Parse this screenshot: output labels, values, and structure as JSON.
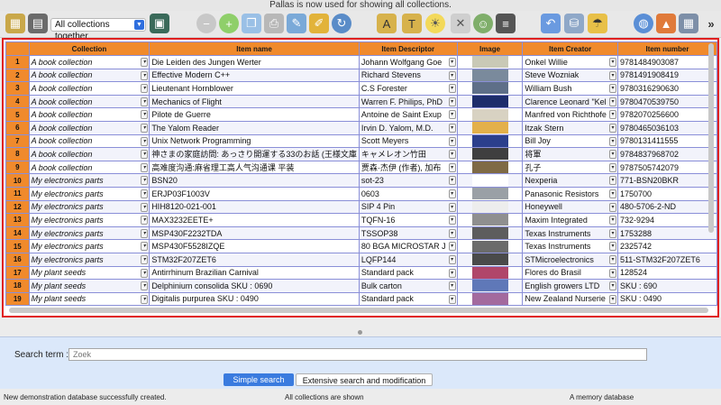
{
  "window": {
    "title": "Pallas is now used for showing all collections."
  },
  "toolbar": {
    "collection_select": "All collections together",
    "icons": [
      "app-icon",
      "barcode-scanner-icon",
      "collection-icon",
      "remove-icon",
      "add-icon",
      "clone-icon",
      "print-icon",
      "edit-icon",
      "edit-item-icon",
      "refresh-icon",
      "text-grow-icon",
      "text-style-icon",
      "lightbulb-icon",
      "tools-icon",
      "user-icon",
      "barcode-icon",
      "undo-icon",
      "database-icon",
      "umbrella-icon",
      "web-icon",
      "image-icon",
      "grid-icon",
      "more-icon"
    ],
    "more_label": "»"
  },
  "table": {
    "columns": [
      "",
      "Collection",
      "Item name",
      "Item Descriptor",
      "Image",
      "Item Creator",
      "Item number"
    ],
    "rows": [
      {
        "n": "1",
        "collection": "A book collection",
        "name": "Die Leiden des Jungen Werter",
        "descriptor": "Johann Wolfgang Goe",
        "creator": "Onkel Willie",
        "number": "9781484903087",
        "thumb": "#c9c9b6"
      },
      {
        "n": "2",
        "collection": "A book collection",
        "name": "Effective Modern C++",
        "descriptor": "Richard Stevens",
        "creator": "Steve Wozniak",
        "number": "9781491908419",
        "thumb": "#7a8a9c"
      },
      {
        "n": "3",
        "collection": "A book collection",
        "name": "Lieutenant Hornblower",
        "descriptor": "C.S Forester",
        "creator": "William Bush",
        "number": "9780316290630",
        "thumb": "#5e6f88"
      },
      {
        "n": "4",
        "collection": "A book collection",
        "name": "Mechanics of Flight",
        "descriptor": "Warren F. Philips, PhD",
        "creator": "Clarence Leonard \"Kel",
        "number": "9780470539750",
        "thumb": "#1d2d6b"
      },
      {
        "n": "5",
        "collection": "A book collection",
        "name": "Pilote de Guerre",
        "descriptor": "Antoine de Saint Exup",
        "creator": "Manfred von Richthofe",
        "number": "9782070256600",
        "thumb": "#d8d2c2"
      },
      {
        "n": "6",
        "collection": "A book collection",
        "name": "The Yalom Reader",
        "descriptor": "Irvin D. Yalom, M.D.",
        "creator": "Itzak Stern",
        "number": "9780465036103",
        "thumb": "#e3b04a"
      },
      {
        "n": "7",
        "collection": "A book collection",
        "name": "Unix Network Programming",
        "descriptor": "Scott Meyers",
        "creator": "Bill Joy",
        "number": "9780131411555",
        "thumb": "#2b3f8c"
      },
      {
        "n": "8",
        "collection": "A book collection",
        "name": "神さまの家庭訪問: あっさり開運する33のお話 (王様文庫",
        "descriptor": "キャメレオン竹田",
        "creator": "将軍",
        "number": "9784837968702",
        "thumb": "#3f3f3f"
      },
      {
        "n": "9",
        "collection": "A book collection",
        "name": "高难度沟通:麻省理工高人气沟通课 平装",
        "descriptor": "贾森·杰伊 (作者), 加布",
        "creator": "孔子",
        "number": "9787505742079",
        "thumb": "#7f6a45"
      },
      {
        "n": "10",
        "collection": "My electronics parts",
        "name": "BSN20",
        "descriptor": "sot-23",
        "creator": "Nexperia",
        "number": "771-BSN20BKR",
        "thumb": "#ffffff"
      },
      {
        "n": "11",
        "collection": "My electronics parts",
        "name": "ERJP03F1003V",
        "descriptor": "0603",
        "creator": "Panasonic Resistors",
        "number": "1750700",
        "thumb": "#9aa0a6"
      },
      {
        "n": "12",
        "collection": "My electronics parts",
        "name": "HIH8120-021-001",
        "descriptor": "SIP 4 Pin",
        "creator": "Honeywell",
        "number": "480-5706-2-ND",
        "thumb": "#ededed"
      },
      {
        "n": "13",
        "collection": "My electronics parts",
        "name": "MAX3232EETE+",
        "descriptor": "TQFN-16",
        "creator": "Maxim Integrated",
        "number": "732-9294",
        "thumb": "#8f8f8f"
      },
      {
        "n": "14",
        "collection": "My electronics parts",
        "name": "MSP430F2232TDA",
        "descriptor": "TSSOP38",
        "creator": "Texas Instruments",
        "number": "1753288",
        "thumb": "#5d5d5d"
      },
      {
        "n": "15",
        "collection": "My electronics parts",
        "name": "MSP430F5528IZQE",
        "descriptor": "80 BGA MICROSTAR J",
        "creator": "Texas Instruments",
        "number": "2325742",
        "thumb": "#6b6b6b"
      },
      {
        "n": "16",
        "collection": "My electronics parts",
        "name": "STM32F207ZET6",
        "descriptor": "LQFP144",
        "creator": "STMicroelectronics",
        "number": "511-STM32F207ZET6",
        "thumb": "#4a4a4a"
      },
      {
        "n": "17",
        "collection": "My plant seeds",
        "name": "Antirrhinum Brazilian Carnival",
        "descriptor": "Standard pack",
        "creator": "Flores do Brasil",
        "number": "128524",
        "thumb": "#b0466a"
      },
      {
        "n": "18",
        "collection": "My plant seeds",
        "name": "Delphinium consolida SKU : 0690",
        "descriptor": "Bulk carton",
        "creator": "English growers LTD",
        "number": "SKU : 690",
        "thumb": "#5f78b8"
      },
      {
        "n": "19",
        "collection": "My plant seeds",
        "name": "Digitalis purpurea SKU : 0490",
        "descriptor": "Standard pack",
        "creator": "New Zealand Nurserie",
        "number": "SKU : 0490",
        "thumb": "#a36a9e"
      }
    ]
  },
  "search": {
    "label": "Search term :",
    "placeholder": "Zoek",
    "value": "",
    "simple_button": "Simple search",
    "extended_button": "Extensive search and modification"
  },
  "status": {
    "left": "New demonstration database successfully created.",
    "center": "All collections are shown",
    "right": "A memory database"
  },
  "colors": {
    "header": "#f08a2c",
    "frame": "#e02020",
    "grid": "#8a8fd8",
    "accent": "#3a7bdf",
    "search_panel": "#dbe8fa"
  }
}
